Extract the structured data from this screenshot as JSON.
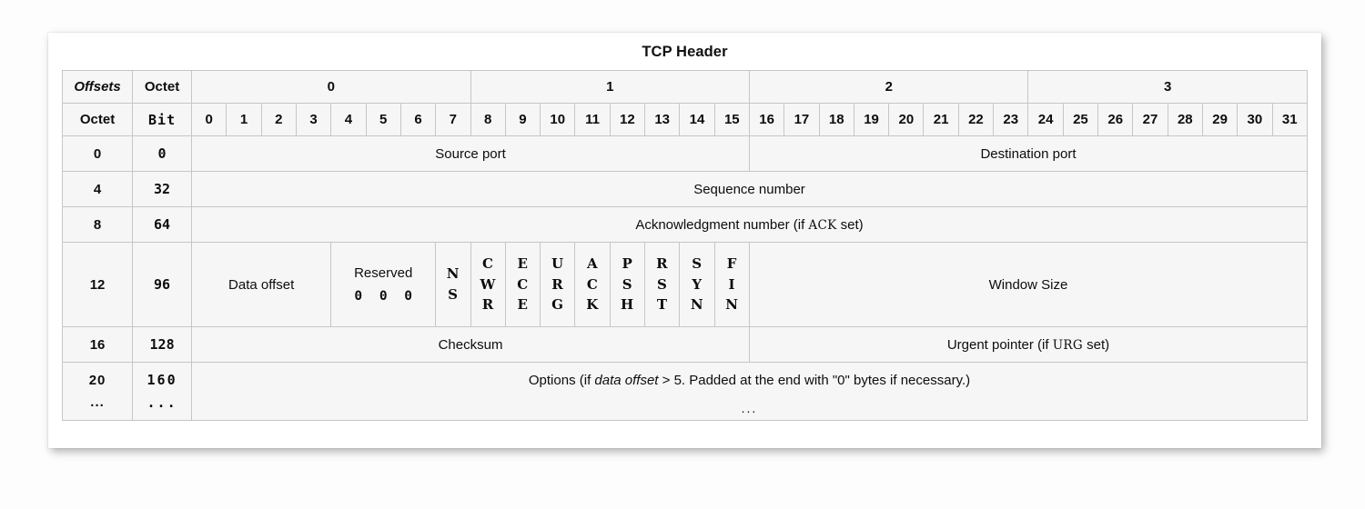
{
  "title": "TCP Header",
  "colors": {
    "accent_blue": "#1c2a8f",
    "options_pink": "#fac5cb",
    "header_gray": "#eeeeee",
    "cell_gray": "#f6f6f6",
    "border": "#c6c6c6"
  },
  "header": {
    "offsets_label": "Offsets",
    "octet_label": "Octet",
    "octet_row_label": "Octet",
    "bit_label": "Bit",
    "octet_groups": [
      "0",
      "1",
      "2",
      "3"
    ],
    "bits": [
      "0",
      "1",
      "2",
      "3",
      "4",
      "5",
      "6",
      "7",
      "8",
      "9",
      "10",
      "11",
      "12",
      "13",
      "14",
      "15",
      "16",
      "17",
      "18",
      "19",
      "20",
      "21",
      "22",
      "23",
      "24",
      "25",
      "26",
      "27",
      "28",
      "29",
      "30",
      "31"
    ]
  },
  "rows": [
    {
      "octet": "0",
      "bit": "0",
      "fields": [
        {
          "name": "source-port",
          "label": "Source port",
          "bits": 16
        },
        {
          "name": "destination-port",
          "label": "Destination port",
          "bits": 16
        }
      ]
    },
    {
      "octet": "4",
      "bit": "32",
      "fields": [
        {
          "name": "sequence-number",
          "label": "Sequence number",
          "bits": 32
        }
      ]
    },
    {
      "octet": "8",
      "bit": "64",
      "fields": [
        {
          "name": "acknowledgment-number",
          "label_pre": "Acknowledgment number (if ",
          "label_sc": "ACK",
          "label_post": " set)",
          "bits": 32
        }
      ]
    },
    {
      "octet": "12",
      "bit": "96",
      "fields": [
        {
          "name": "data-offset",
          "label": "Data offset",
          "bits": 4
        },
        {
          "name": "reserved",
          "label": "Reserved",
          "zeros": "0 0 0",
          "bits": 3
        },
        {
          "name": "flag-ns",
          "label": "NS",
          "bits": 1
        },
        {
          "name": "flag-cwr",
          "label": "CWR",
          "bits": 1
        },
        {
          "name": "flag-ece",
          "label": "ECE",
          "bits": 1
        },
        {
          "name": "flag-urg",
          "label": "URG",
          "bits": 1
        },
        {
          "name": "flag-ack",
          "label": "ACK",
          "bits": 1
        },
        {
          "name": "flag-psh",
          "label": "PSH",
          "bits": 1
        },
        {
          "name": "flag-rst",
          "label": "RST",
          "bits": 1
        },
        {
          "name": "flag-syn",
          "label": "SYN",
          "bits": 1
        },
        {
          "name": "flag-fin",
          "label": "FIN",
          "bits": 1
        },
        {
          "name": "window-size",
          "label": "Window Size",
          "bits": 16
        }
      ]
    },
    {
      "octet": "16",
      "bit": "128",
      "fields": [
        {
          "name": "checksum",
          "label": "Checksum",
          "bits": 16
        },
        {
          "name": "urgent-pointer",
          "label_pre": "Urgent pointer (if ",
          "label_sc": "URG",
          "label_post": " set)",
          "bits": 16
        }
      ]
    },
    {
      "octet": "20",
      "octet_cont": "...",
      "bit": "160",
      "bit_cont": "...",
      "fields": [
        {
          "name": "options",
          "bits": 32,
          "opt_pre": "Options (if ",
          "opt_ital": "data offset",
          "opt_post": " > 5. Padded at the end with \"0\" bytes if necessary.)",
          "opt_dots": "..."
        }
      ]
    }
  ],
  "row_labels": {
    "r0": {
      "octet": "0",
      "bit": "0"
    },
    "r1": {
      "octet": "4",
      "bit": "32"
    },
    "r2": {
      "octet": "8",
      "bit": "64"
    },
    "r3": {
      "octet": "12",
      "bit": "96"
    },
    "r4": {
      "octet": "16",
      "bit": "128"
    },
    "r5": {
      "octet": "20",
      "bit": "160",
      "octet_cont": "...",
      "bit_cont": "..."
    }
  },
  "fields": {
    "source_port": "Source port",
    "destination_port": "Destination port",
    "sequence_number": "Sequence number",
    "ack_pre": "Acknowledgment number (if ",
    "ack_sc": "ACK",
    "ack_post": " set)",
    "data_offset": "Data offset",
    "reserved": "Reserved",
    "reserved_zeros": "0 0 0",
    "window_size": "Window Size",
    "checksum": "Checksum",
    "urg_pre": "Urgent pointer (if ",
    "urg_sc": "URG",
    "urg_post": " set)",
    "options_pre": "Options (if ",
    "options_ital": "data offset",
    "options_post": " > 5. Padded at the end with \"0\" bytes if necessary.)",
    "options_dots": "..."
  },
  "flags": [
    {
      "id": "ns",
      "letters": [
        "N",
        "S"
      ]
    },
    {
      "id": "cwr",
      "letters": [
        "C",
        "W",
        "R"
      ]
    },
    {
      "id": "ece",
      "letters": [
        "E",
        "C",
        "E"
      ]
    },
    {
      "id": "urg",
      "letters": [
        "U",
        "R",
        "G"
      ]
    },
    {
      "id": "ack",
      "letters": [
        "A",
        "C",
        "K"
      ]
    },
    {
      "id": "psh",
      "letters": [
        "P",
        "S",
        "H"
      ]
    },
    {
      "id": "rst",
      "letters": [
        "R",
        "S",
        "T"
      ]
    },
    {
      "id": "syn",
      "letters": [
        "S",
        "Y",
        "N"
      ]
    },
    {
      "id": "fin",
      "letters": [
        "F",
        "I",
        "N"
      ]
    }
  ]
}
